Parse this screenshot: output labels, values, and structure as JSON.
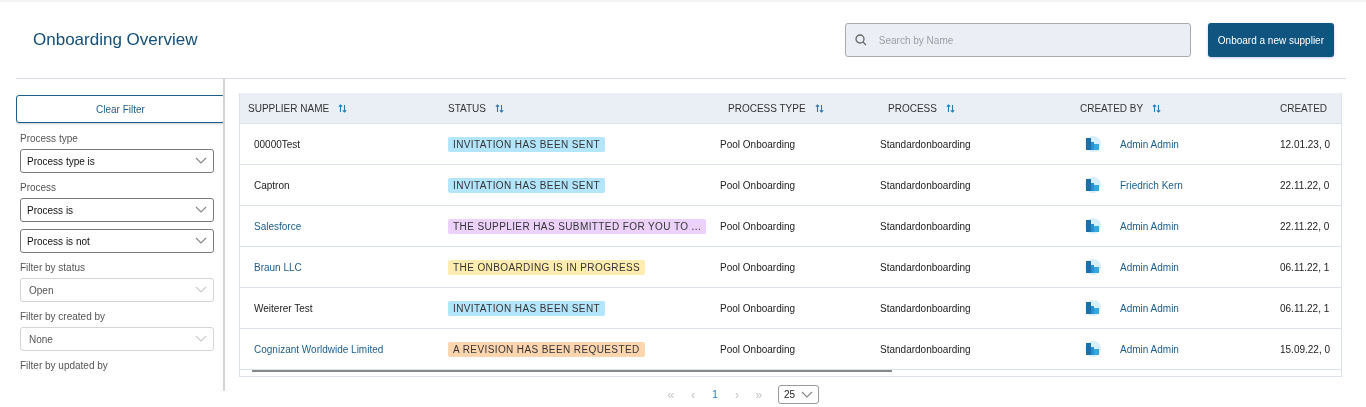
{
  "header": {
    "title": "Onboarding Overview",
    "search": {
      "placeholder": "Search by Name"
    },
    "primary_button": "Onboard a new supplier"
  },
  "sidebar": {
    "clear_button": "Clear Filter",
    "filters": [
      {
        "label": "Process type",
        "selects": [
          {
            "value": "Process type is",
            "disabled": false
          }
        ]
      },
      {
        "label": "Process",
        "selects": [
          {
            "value": "Process is",
            "disabled": false
          },
          {
            "value": "Process is not",
            "disabled": false
          }
        ]
      },
      {
        "label": "Filter by status",
        "selects": [
          {
            "value": "Open",
            "disabled": true
          }
        ]
      },
      {
        "label": "Filter by created by",
        "selects": [
          {
            "value": "None",
            "disabled": true
          }
        ]
      },
      {
        "label": "Filter by updated by"
      }
    ]
  },
  "table": {
    "columns": [
      "SUPPLIER NAME",
      "STATUS",
      "PROCESS TYPE",
      "PROCESS",
      "CREATED BY",
      "CREATED"
    ],
    "rows": [
      {
        "supplier": "00000Test",
        "link": false,
        "status": {
          "label": "INVITATION HAS BEEN SENT",
          "color": "#b3e5fc"
        },
        "process_type": "Pool Onboarding",
        "process": "Standardonboarding",
        "created_by": "Admin Admin",
        "created": "12.01.23, 0"
      },
      {
        "supplier": "Captron",
        "link": false,
        "status": {
          "label": "INVITATION HAS BEEN SENT",
          "color": "#b3e5fc"
        },
        "process_type": "Pool Onboarding",
        "process": "Standardonboarding",
        "created_by": "Friedrich Kern",
        "created": "22.11.22, 0"
      },
      {
        "supplier": "Salesforce",
        "link": true,
        "status": {
          "label": "THE SUPPLIER HAS SUBMITTED FOR YOU TO ...",
          "color": "#ecd2fb"
        },
        "process_type": "Pool Onboarding",
        "process": "Standardonboarding",
        "created_by": "Admin Admin",
        "created": "22.11.22, 0"
      },
      {
        "supplier": "Braun LLC",
        "link": true,
        "status": {
          "label": "THE ONBOARDING IS IN PROGRESS",
          "color": "#ffecb0"
        },
        "process_type": "Pool Onboarding",
        "process": "Standardonboarding",
        "created_by": "Admin Admin",
        "created": "06.11.22, 1"
      },
      {
        "supplier": "Weiterer Test",
        "link": false,
        "status": {
          "label": "INVITATION HAS BEEN SENT",
          "color": "#b3e5fc"
        },
        "process_type": "Pool Onboarding",
        "process": "Standardonboarding",
        "created_by": "Admin Admin",
        "created": "06.11.22, 1"
      },
      {
        "supplier": "Cognizant Worldwide Limited",
        "link": true,
        "status": {
          "label": "A REVISION HAS BEEN REQUESTED",
          "color": "#fdd6b0"
        },
        "process_type": "Pool Onboarding",
        "process": "Standardonboarding",
        "created_by": "Admin Admin",
        "created": "15.09.22, 0"
      }
    ]
  },
  "pagination": {
    "first": "«",
    "prev": "‹",
    "pages": [
      {
        "label": "1",
        "selected": true
      }
    ],
    "next": "›",
    "last": "»",
    "page_size": "25"
  }
}
